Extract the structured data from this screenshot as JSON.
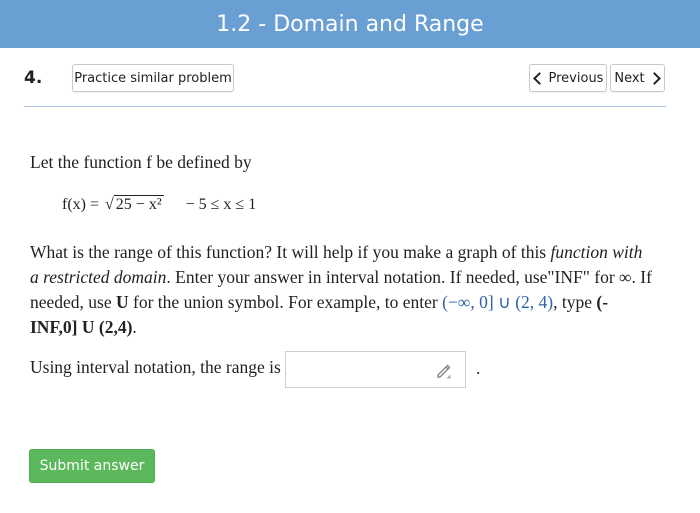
{
  "header": {
    "title": "1.2 - Domain and Range"
  },
  "question": {
    "number": "4.",
    "practice_label": "Practice similar problem",
    "prev_label": "Previous",
    "next_label": "Next",
    "intro": "Let the function f be defined by",
    "formula": {
      "lhs": "f(x) =",
      "radicand": "25 − x²",
      "domain": "− 5 ≤ x ≤ 1"
    },
    "instructions": {
      "a": "What is the range of this function? It will help if you make a graph of this ",
      "b": "function with a restricted domain",
      "c": ". Enter your answer in interval notation. If needed, use\"INF\" for ∞. If needed, use ",
      "d": "U",
      "e": " for the union symbol. For example, to enter ",
      "f": "(−∞, 0] ∪ (2, 4)",
      "g": ", type ",
      "h": "(-INF,0] U (2,4)",
      "i": "."
    },
    "answer_prompt": "Using interval notation, the range is",
    "answer_value": "",
    "answer_suffix": ".",
    "submit_label": "Submit answer"
  },
  "colors": {
    "header": "#6a9fd4",
    "submit": "#5cb85c",
    "link": "#2d62a8"
  }
}
